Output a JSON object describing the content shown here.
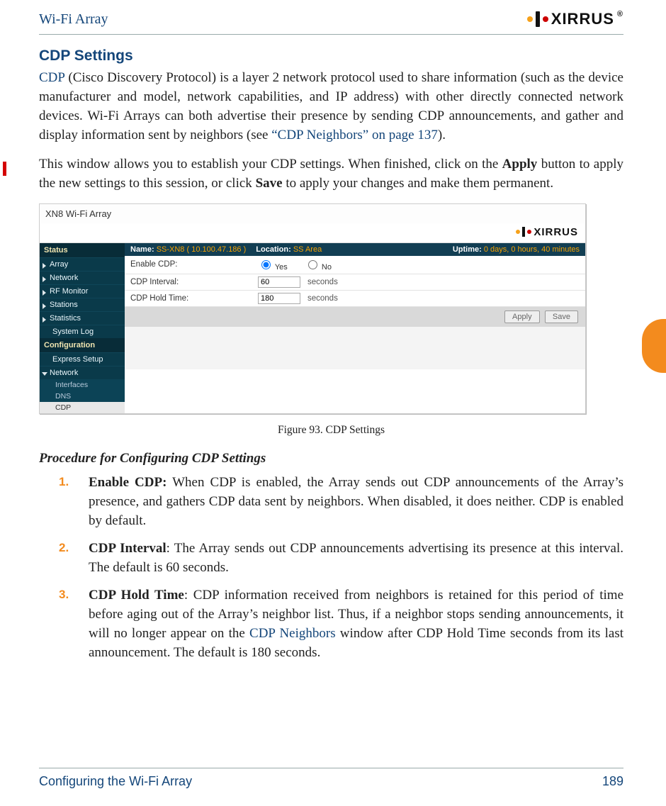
{
  "header": {
    "title": "Wi-Fi Array",
    "logo_text": "XIRRUS"
  },
  "section": {
    "title": "CDP Settings"
  },
  "p1": {
    "link1": "CDP",
    "text": " (Cisco Discovery Protocol) is a layer 2 network protocol used to share information (such as the device manufacturer and model, network capabilities, and IP address) with other directly connected network devices. Wi-Fi Arrays can both advertise their presence by sending CDP announcements, and gather and display information sent by neighbors (see ",
    "link2": "“CDP Neighbors” on page 137",
    "tail": ")."
  },
  "p2": {
    "pre": "This window allows you to establish your CDP settings. When finished, click on the ",
    "b1": "Apply",
    "mid": " button to apply the new settings to this session, or click ",
    "b2": "Save",
    "post": " to apply your changes and make them permanent."
  },
  "shot": {
    "window_title": "XN8 Wi-Fi Array",
    "logo": "XIRRUS",
    "status": {
      "name_lbl": "Name:",
      "name_val": "SS-XN8   ( 10.100.47.186 )",
      "loc_lbl": "Location:",
      "loc_val": "SS Area",
      "up_lbl": "Uptime:",
      "up_val": "0 days, 0 hours, 40 minutes"
    },
    "sidebar": {
      "head1": "Status",
      "items1": [
        "Array",
        "Network",
        "RF Monitor",
        "Stations",
        "Statistics"
      ],
      "syslog": "System Log",
      "head2": "Configuration",
      "express": "Express Setup",
      "network": "Network",
      "subs": [
        "Interfaces",
        "DNS",
        "CDP"
      ]
    },
    "form": {
      "enable_lbl": "Enable CDP:",
      "yes": "Yes",
      "no": "No",
      "interval_lbl": "CDP Interval:",
      "interval_val": "60",
      "sec": "seconds",
      "hold_lbl": "CDP Hold Time:",
      "hold_val": "180"
    },
    "buttons": {
      "apply": "Apply",
      "save": "Save"
    }
  },
  "caption": "Figure 93. CDP Settings",
  "procedure": {
    "heading": "Procedure for Configuring CDP Settings",
    "s1": {
      "b": "Enable CDP:",
      "t": " When CDP is enabled, the Array sends out CDP announcements of the Array’s presence, and gathers CDP data sent by neighbors. When disabled, it does neither. CDP is enabled by default."
    },
    "s2": {
      "b": "CDP Interval",
      "t": ": The Array sends out CDP announcements advertising its presence at this interval. The default is 60 seconds."
    },
    "s3": {
      "b": "CDP Hold Time",
      "t1": ": CDP information received from neighbors is retained for this period of time before aging out of the Array’s neighbor list. Thus, if a neighbor stops sending announcements, it will no longer appear on the ",
      "link": "CDP Neighbors",
      "t2": " window after CDP Hold Time seconds from its last announcement. The default is 180 seconds."
    }
  },
  "footer": {
    "left": "Configuring the Wi-Fi Array",
    "right": "189"
  }
}
